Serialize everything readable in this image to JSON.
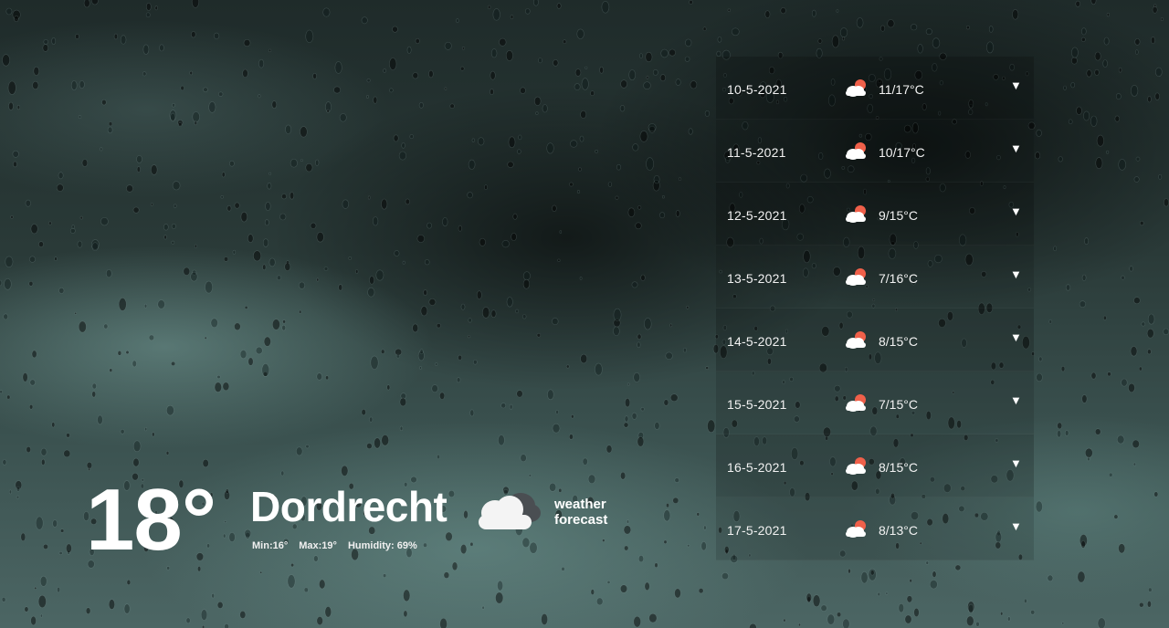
{
  "current": {
    "temperature": "18°",
    "city": "Dordrecht",
    "min": "Min:16°",
    "max": "Max:19°",
    "humidity": "Humidity: 69%",
    "icon": "cloud-icon"
  },
  "brand": {
    "line1": "weather",
    "line2": "forecast"
  },
  "forecast": [
    {
      "date": "10-5-2021",
      "temp": "11/17°C",
      "icon": "partly-cloudy-icon",
      "toggle": "▼"
    },
    {
      "date": "11-5-2021",
      "temp": "10/17°C",
      "icon": "partly-cloudy-icon",
      "toggle": "▼"
    },
    {
      "date": "12-5-2021",
      "temp": "9/15°C",
      "icon": "partly-cloudy-icon",
      "toggle": "▼"
    },
    {
      "date": "13-5-2021",
      "temp": "7/16°C",
      "icon": "partly-cloudy-icon",
      "toggle": "▼"
    },
    {
      "date": "14-5-2021",
      "temp": "8/15°C",
      "icon": "partly-cloudy-icon",
      "toggle": "▼"
    },
    {
      "date": "15-5-2021",
      "temp": "7/15°C",
      "icon": "partly-cloudy-icon",
      "toggle": "▼"
    },
    {
      "date": "16-5-2021",
      "temp": "8/15°C",
      "icon": "partly-cloudy-icon",
      "toggle": "▼"
    },
    {
      "date": "17-5-2021",
      "temp": "8/13°C",
      "icon": "partly-cloudy-icon",
      "toggle": "▼"
    }
  ]
}
